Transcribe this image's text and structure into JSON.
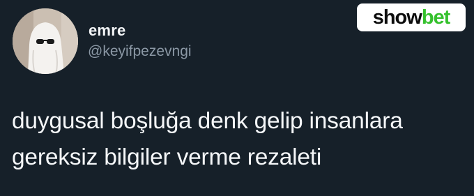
{
  "author": {
    "display_name": "emre",
    "handle": "@keyifpezevngi",
    "avatar_icon": "ghost-with-sunglasses-avatar"
  },
  "watermark": {
    "brand_part_1": "show",
    "brand_part_2": "bet",
    "brand_color_1": "#0d0d0d",
    "brand_color_2": "#35c12d"
  },
  "tweet": {
    "lines": [
      "duygusal boşluğa denk gelip insanlara",
      "gereksiz bilgiler verme rezaleti"
    ]
  },
  "colors": {
    "background": "#162029",
    "text": "#f5f7f9",
    "secondary_text": "#8b98a5"
  }
}
